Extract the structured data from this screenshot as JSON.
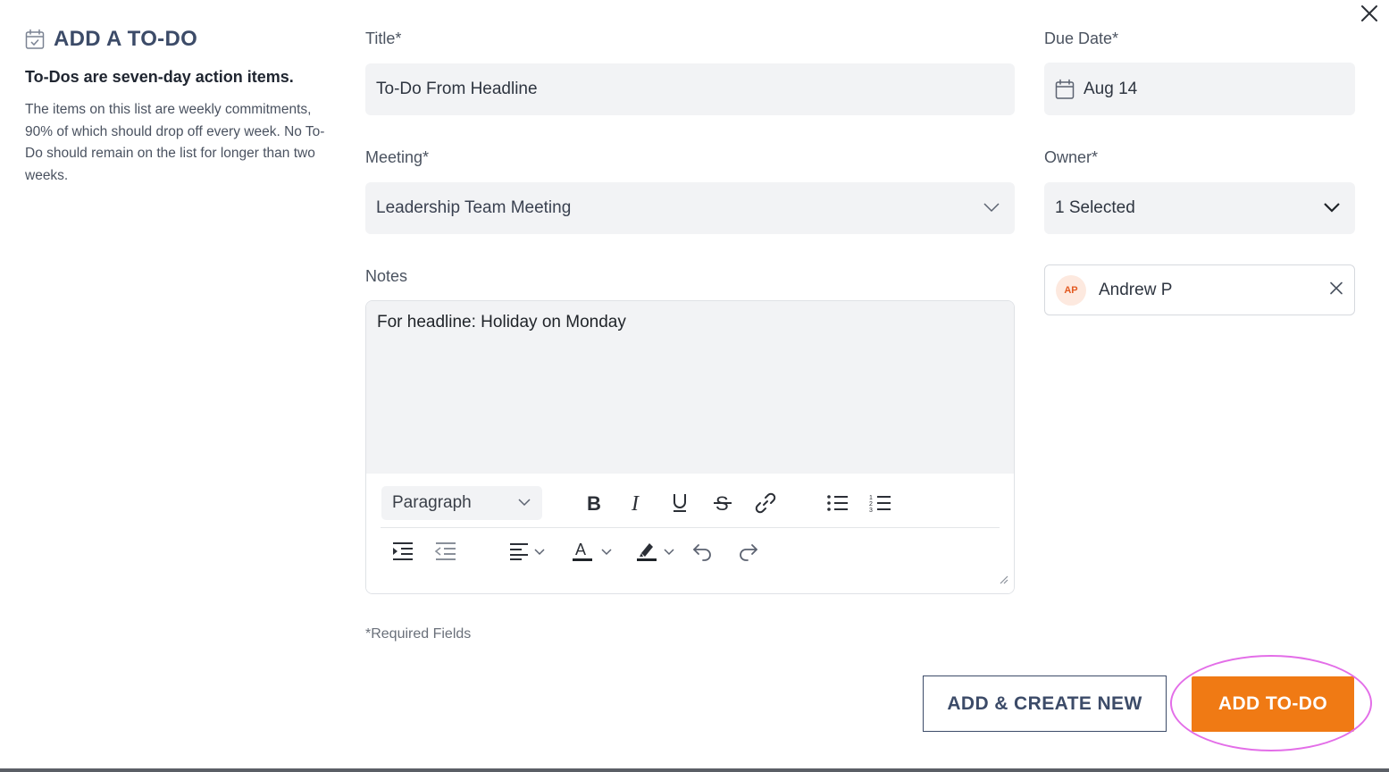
{
  "modal": {
    "title": "ADD A TO-DO",
    "subtitle": "To-Dos are seven-day action items.",
    "description": "The items on this list are weekly commitments, 90% of which should drop off every week. No To-Do should remain on the list for longer than two weeks."
  },
  "form": {
    "title_label": "Title*",
    "title_value": "To-Do From Headline",
    "due_label": "Due Date*",
    "due_value": "Aug 14",
    "meeting_label": "Meeting*",
    "meeting_value": "Leadership Team Meeting",
    "owner_label": "Owner*",
    "owner_value": "1 Selected",
    "notes_label": "Notes",
    "notes_value": "For headline: Holiday on Monday",
    "paragraph_style": "Paragraph",
    "required_note": "*Required Fields"
  },
  "owner_chip": {
    "initials": "AP",
    "name": "Andrew P"
  },
  "buttons": {
    "add_create_new": "ADD & CREATE NEW",
    "add_todo": "ADD TO-DO"
  },
  "colors": {
    "accent": "#f07a14",
    "heading": "#3c4b68",
    "highlight": "#e36ee8"
  }
}
